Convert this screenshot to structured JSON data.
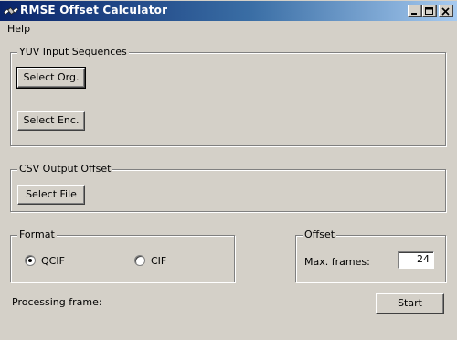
{
  "window": {
    "title": "RMSE Offset Calculator",
    "icon": "satellite-icon",
    "controls": [
      "minimize-icon",
      "maximize-icon",
      "close-icon"
    ]
  },
  "menu": {
    "items": [
      "Help"
    ]
  },
  "yuv_group": {
    "title": "YUV Input Sequences",
    "select_org_label": "Select Org.",
    "select_enc_label": "Select Enc."
  },
  "csv_group": {
    "title": "CSV Output Offset",
    "select_file_label": "Select File"
  },
  "format_group": {
    "title": "Format",
    "options": [
      "QCIF",
      "CIF"
    ],
    "selected": "QCIF"
  },
  "offset_group": {
    "title": "Offset",
    "max_frames_label": "Max. frames:",
    "max_frames_value": "24"
  },
  "status": {
    "processing_label": "Processing frame:"
  },
  "start_label": "Start",
  "colors": {
    "titlebar_start": "#0a246a",
    "titlebar_end": "#a6caf0",
    "face": "#d4d0c8"
  }
}
